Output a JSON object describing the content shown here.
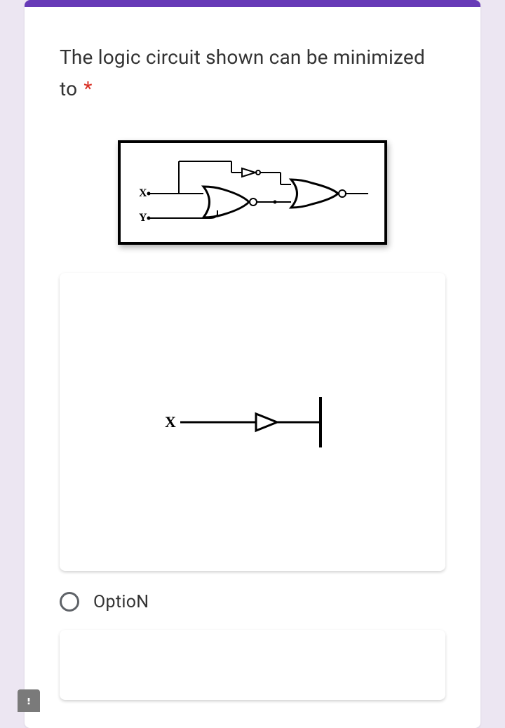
{
  "question": {
    "text": "The logic circuit shown can be minimized to",
    "required_mark": "*"
  },
  "main_circuit": {
    "inputs": [
      "X",
      "Y"
    ]
  },
  "options": [
    {
      "diagram_input": "X",
      "label": "OptioN"
    }
  ]
}
